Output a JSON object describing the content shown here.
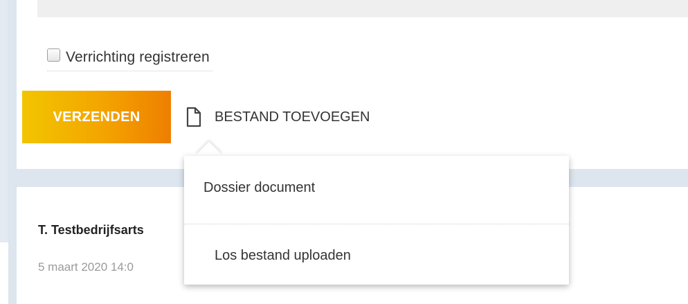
{
  "form": {
    "checkbox_label": "Verrichting registreren",
    "checkbox_checked": false,
    "send_label": "VERZENDEN",
    "add_file_label": "BESTAND TOEVOEGEN"
  },
  "message": {
    "author": "T. Testbedrijfsarts",
    "date": "5 maart 2020 14:0"
  },
  "file_menu": {
    "items": [
      {
        "label": "Dossier document"
      },
      {
        "label": "Los bestand uploaden"
      }
    ]
  },
  "colors": {
    "send_gradient_start": "#f2c500",
    "send_gradient_end": "#ee7f00",
    "background": "#dde5ee"
  }
}
